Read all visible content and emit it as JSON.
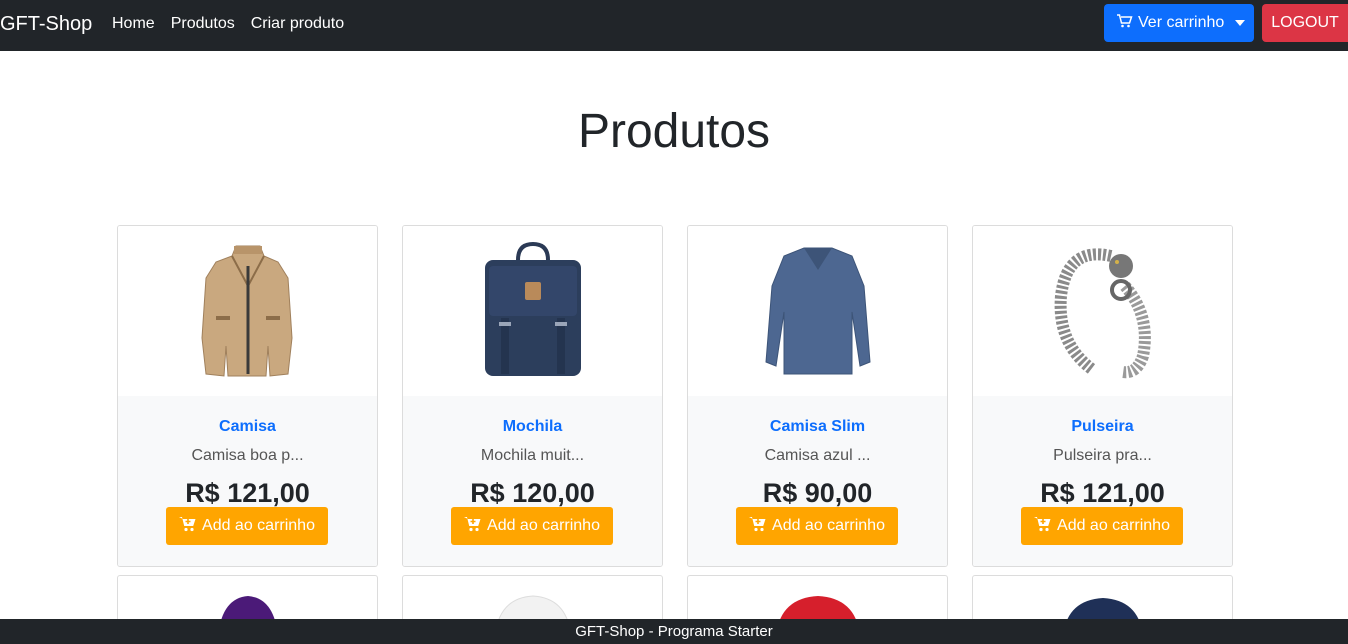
{
  "nav": {
    "brand": "GFT-Shop",
    "links": [
      "Home",
      "Produtos",
      "Criar produto"
    ],
    "cart_label": "Ver carrinho",
    "logout_label": "LOGOUT"
  },
  "title": "Produtos",
  "products": [
    {
      "name": "Camisa",
      "desc": "Camisa boa p...",
      "price": "R$ 121,00",
      "button": "Add ao carrinho",
      "image": "jacket"
    },
    {
      "name": "Mochila",
      "desc": "Mochila muit...",
      "price": "R$ 120,00",
      "button": "Add ao carrinho",
      "image": "backpack"
    },
    {
      "name": "Camisa Slim",
      "desc": "Camisa azul ...",
      "price": "R$ 90,00",
      "button": "Add ao carrinho",
      "image": "sweater"
    },
    {
      "name": "Pulseira",
      "desc": "Pulseira pra...",
      "price": "R$ 121,00",
      "button": "Add ao carrinho",
      "image": "bracelet"
    }
  ],
  "row2_images": [
    "purple-garment",
    "white-shirt",
    "red-shirt",
    "navy-shirt"
  ],
  "footer": "GFT-Shop - Programa Starter",
  "colors": {
    "navbar": "#212529",
    "primary": "#0d6efd",
    "danger": "#dc3545",
    "add": "#ffa500"
  }
}
